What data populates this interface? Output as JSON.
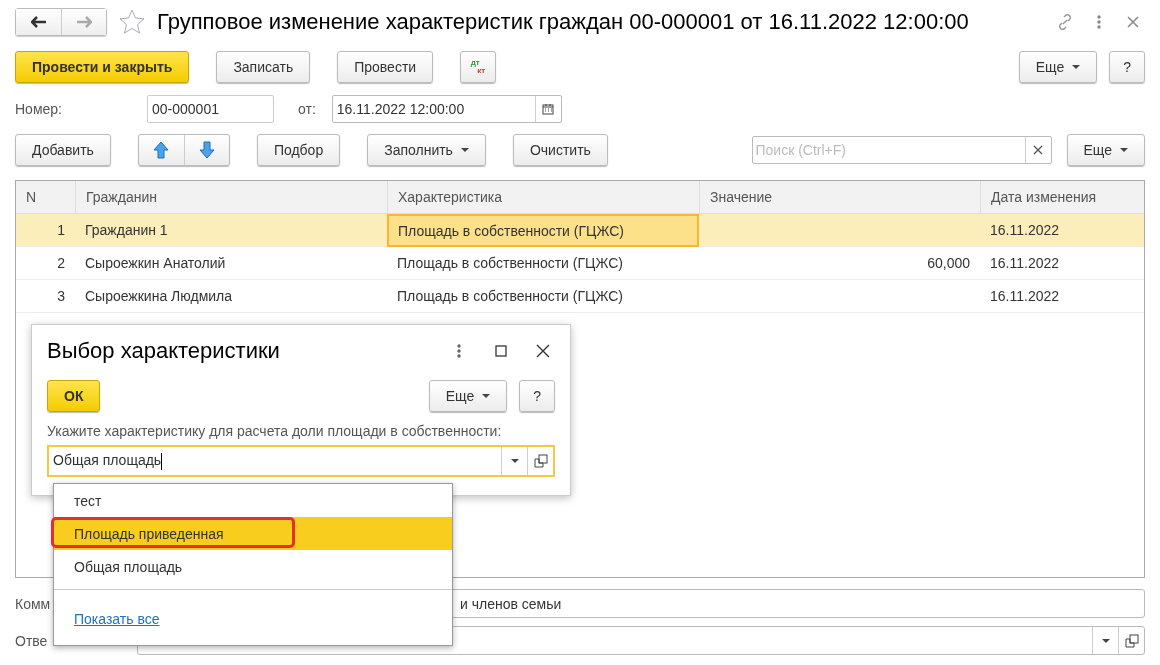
{
  "window": {
    "title": "Групповое изменение характеристик граждан 00-000001 от 16.11.2022 12:00:00"
  },
  "command_bar": {
    "buttons": [
      {
        "kind": "default",
        "label": "Провести и закрыть"
      },
      {
        "kind": "plain",
        "label": "Записать"
      },
      {
        "kind": "plain",
        "label": "Провести"
      },
      {
        "kind": "dtkt",
        "top": "дт",
        "bottom": "кт"
      }
    ],
    "more": "Еще",
    "help": "?"
  },
  "header": {
    "number_label": "Номер:",
    "number": "00-000001",
    "date_label": "от:",
    "date": "16.11.2022 12:00:00"
  },
  "table_toolbar": {
    "buttons": [
      {
        "kind": "plain",
        "label": "Добавить"
      },
      {
        "kind": "arrows"
      },
      {
        "kind": "plain",
        "label": "Подбор"
      },
      {
        "kind": "menu",
        "label": "Заполнить"
      },
      {
        "kind": "plain",
        "label": "Очистить"
      }
    ],
    "search_placeholder": "Поиск (Ctrl+F)",
    "more": "Еще"
  },
  "table": {
    "columns": [
      "N",
      "Гражданин",
      "Характеристика",
      "Значение",
      "Дата изменения"
    ],
    "rows": [
      {
        "n": "1",
        "citizen": "Гражданин 1",
        "characteristic": "Площадь в собственности (ГЦЖС)",
        "value": "",
        "date": "16.11.2022",
        "selected": true
      },
      {
        "n": "2",
        "citizen": "Сыроежкин Анатолий",
        "characteristic": "Площадь в собственности (ГЦЖС)",
        "value": "60,000",
        "date": "16.11.2022",
        "selected": false
      },
      {
        "n": "3",
        "citizen": "Сыроежкина Людмила",
        "characteristic": "Площадь в собственности (ГЦЖС)",
        "value": "",
        "date": "16.11.2022",
        "selected": false
      }
    ]
  },
  "comment": {
    "label": "Комм",
    "value": "и членов семьи"
  },
  "responsible": {
    "label": "Отве"
  },
  "dialog": {
    "title": "Выбор характеристики",
    "ok": "ОК",
    "more": "Еще",
    "help": "?",
    "prompt": "Укажите характеристику для расчета доли площади в собственности:",
    "value": "Общая площадь"
  },
  "dropdown": {
    "items": [
      {
        "label": "тест",
        "selected": false,
        "marked": false
      },
      {
        "label": "Площадь приведенная",
        "selected": true,
        "marked": true
      },
      {
        "label": "Общая площадь",
        "selected": false,
        "marked": false
      }
    ],
    "show_all": "Показать все"
  }
}
